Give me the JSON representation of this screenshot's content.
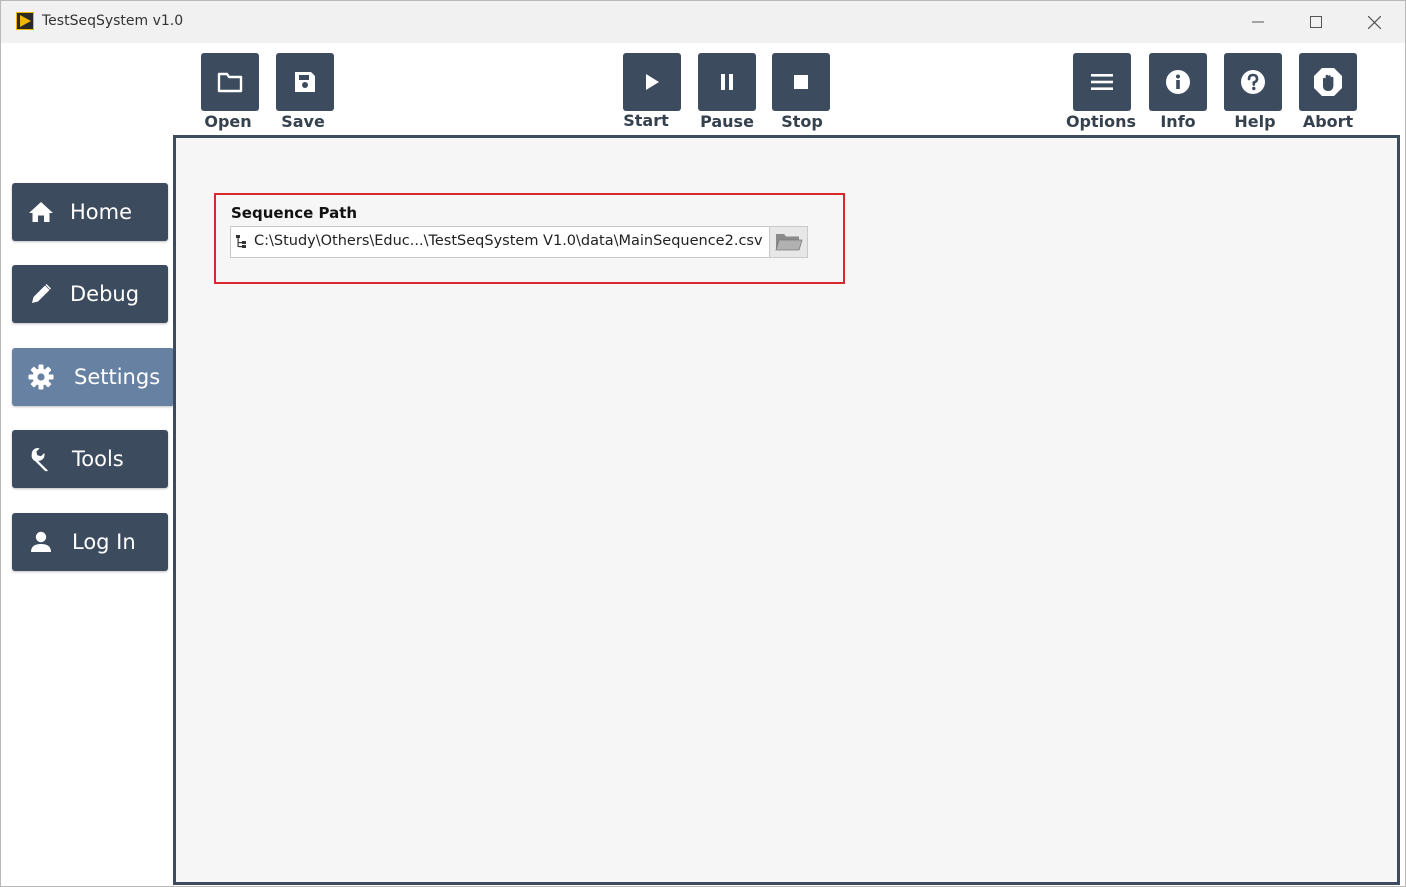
{
  "window": {
    "title": "TestSeqSystem v1.0",
    "controls": {
      "minimize": "minimize-icon",
      "maximize": "maximize-icon",
      "close": "close-icon"
    }
  },
  "toolbar": {
    "open_label": "Open",
    "save_label": "Save",
    "start_label": "Start",
    "pause_label": "Pause",
    "stop_label": "Stop",
    "options_label": "Options",
    "info_label": "Info",
    "help_label": "Help",
    "abort_label": "Abort"
  },
  "sidebar": {
    "items": [
      {
        "label": "Home",
        "icon": "home-icon",
        "active": false
      },
      {
        "label": "Debug",
        "icon": "pencil-icon",
        "active": false
      },
      {
        "label": "Settings",
        "icon": "gear-icon",
        "active": true
      },
      {
        "label": "Tools",
        "icon": "wrench-icon",
        "active": false
      },
      {
        "label": "Log In",
        "icon": "user-icon",
        "active": false
      }
    ]
  },
  "settings": {
    "sequence_path_label": "Sequence Path",
    "sequence_path_value": "C:\\Study\\Others\\Educ...\\TestSeqSystem V1.0\\data\\MainSequence2.csv"
  },
  "colors": {
    "toolbar_button": "#3c4b5e",
    "active_nav": "#6781a2",
    "highlight_border": "#d9262f",
    "panel_background": "#f6f6f6"
  }
}
